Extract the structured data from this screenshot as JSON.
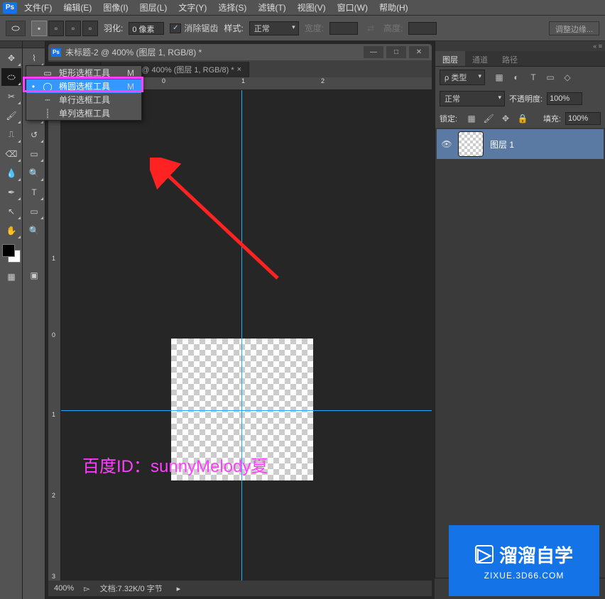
{
  "menu": {
    "ps": "Ps",
    "items": [
      "文件(F)",
      "编辑(E)",
      "图像(I)",
      "图层(L)",
      "文字(Y)",
      "选择(S)",
      "滤镜(T)",
      "视图(V)",
      "窗口(W)",
      "帮助(H)"
    ]
  },
  "options": {
    "feather_label": "羽化:",
    "feather_value": "0 像素",
    "antialias": "消除锯齿",
    "style_label": "样式:",
    "style_value": "正常",
    "width_label": "宽度:",
    "height_label": "高度:",
    "refine": "调整边缘..."
  },
  "doc_title": "未标题-2 @ 400% (图层 1, RGB/8) *",
  "tabs": [
    {
      "label": "RGB/8) *",
      "active": true
    },
    {
      "label": "未标题-2 @ 400% (图层 1, RGB/8) *",
      "active": false
    }
  ],
  "ruler_h": [
    "0",
    "1",
    "2"
  ],
  "ruler_v": [
    "1",
    "0",
    "1",
    "2",
    "3"
  ],
  "watermark": "百度ID：sunnyMelody夏",
  "status": {
    "zoom": "400%",
    "info": "文档:7.32K/0 字节"
  },
  "flyout": {
    "items": [
      {
        "label": "矩形选框工具",
        "key": "M",
        "icon": "▭"
      },
      {
        "label": "椭圆选框工具",
        "key": "M",
        "icon": "◯",
        "active": true
      },
      {
        "label": "单行选框工具",
        "key": "",
        "icon": "┄"
      },
      {
        "label": "单列选框工具",
        "key": "",
        "icon": "┊"
      }
    ]
  },
  "panels": {
    "tabs": [
      "图层",
      "通道",
      "路径"
    ],
    "filter_kind": "ρ 类型",
    "blend_mode": "正常",
    "opacity_label": "不透明度:",
    "opacity_value": "100%",
    "lock_label": "锁定:",
    "fill_label": "填充:",
    "fill_value": "100%",
    "layer_name": "图层 1"
  },
  "brand": {
    "name": "溜溜自学",
    "url": "ZIXUE.3D66.COM"
  }
}
